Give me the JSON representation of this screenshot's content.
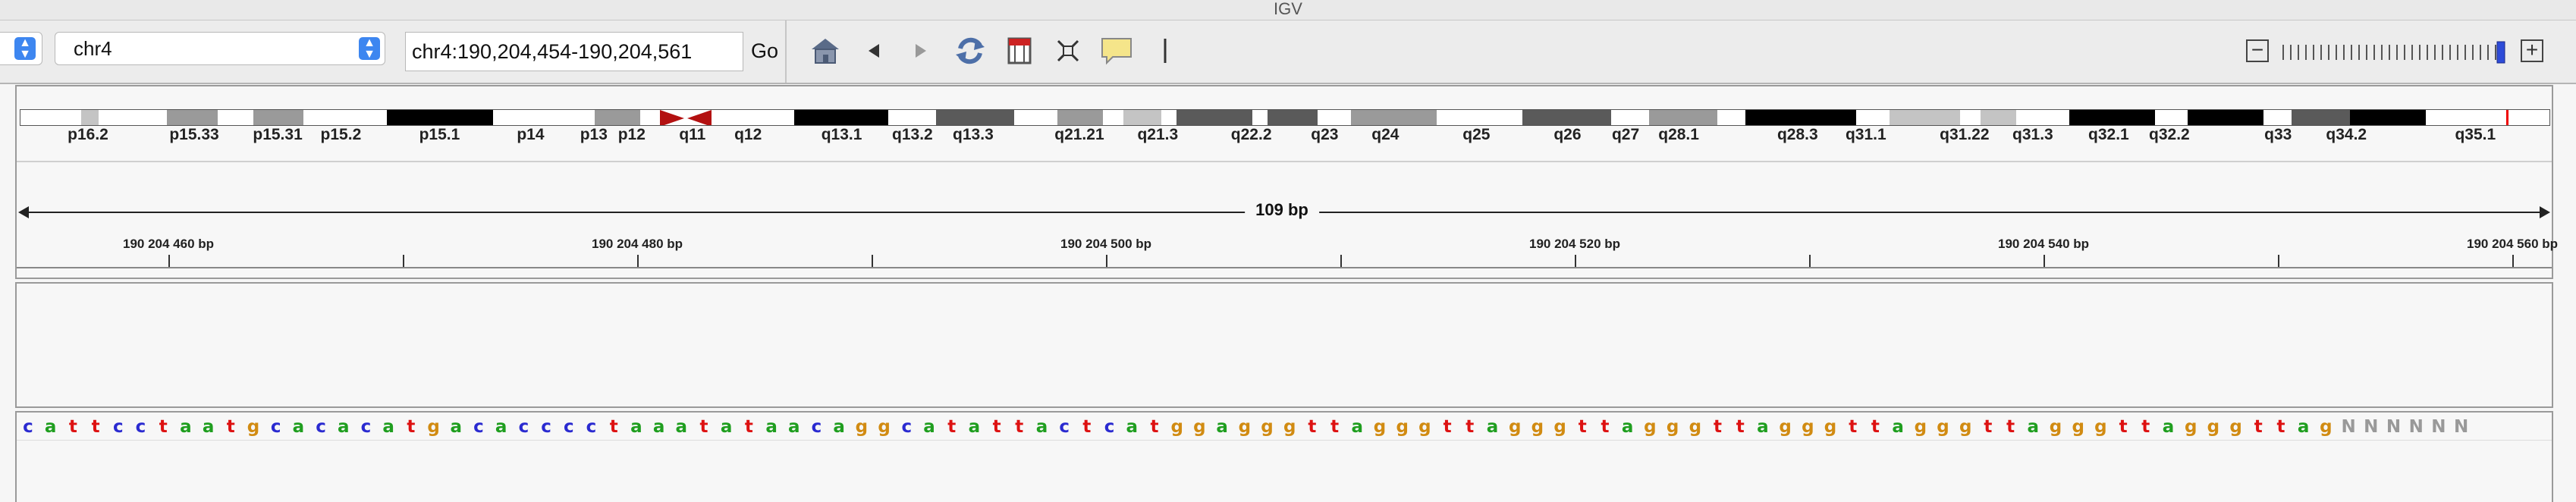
{
  "window": {
    "title": "IGV"
  },
  "toolbar": {
    "genome_select": "",
    "chromosome_select": "chr4",
    "locus": "chr4:190,204,454-190,204,561",
    "go_label": "Go",
    "icons": [
      "home-icon",
      "back-icon",
      "forward-icon",
      "refresh-icon",
      "roi-icon",
      "resize-icon",
      "popup-info-icon",
      "ruler-icon"
    ],
    "zoom_out": "−",
    "zoom_in": "+"
  },
  "ideogram": {
    "bands": [
      {
        "label": "p16.2",
        "start": 0.0,
        "end": 0.024,
        "stain": "white"
      },
      {
        "label": "",
        "start": 0.024,
        "end": 0.031,
        "stain": "lightgray"
      },
      {
        "label": "",
        "start": 0.031,
        "end": 0.058,
        "stain": "white"
      },
      {
        "label": "p15.33",
        "start": 0.058,
        "end": 0.078,
        "stain": "gray"
      },
      {
        "label": "",
        "start": 0.078,
        "end": 0.092,
        "stain": "white"
      },
      {
        "label": "p15.31",
        "start": 0.092,
        "end": 0.112,
        "stain": "gray"
      },
      {
        "label": "p15.2",
        "start": 0.112,
        "end": 0.145,
        "stain": "white"
      },
      {
        "label": "p15.1",
        "start": 0.145,
        "end": 0.187,
        "stain": "black"
      },
      {
        "label": "",
        "start": 0.187,
        "end": 0.216,
        "stain": "white"
      },
      {
        "label": "p14",
        "start": 0.216,
        "end": 0.227,
        "stain": "white"
      },
      {
        "label": "p13",
        "start": 0.227,
        "end": 0.245,
        "stain": "gray"
      },
      {
        "label": "p12",
        "start": 0.245,
        "end": 0.253,
        "stain": "white"
      },
      {
        "label": "",
        "start": 0.253,
        "end": 0.263,
        "stain": "white"
      },
      {
        "label": "q11",
        "start": 0.263,
        "end": 0.27,
        "stain": "white"
      },
      {
        "label": "",
        "start": 0.27,
        "end": 0.28,
        "stain": "white"
      },
      {
        "label": "q12",
        "start": 0.28,
        "end": 0.306,
        "stain": "white"
      },
      {
        "label": "q13.1",
        "start": 0.306,
        "end": 0.343,
        "stain": "black"
      },
      {
        "label": "q13.2",
        "start": 0.343,
        "end": 0.362,
        "stain": "white"
      },
      {
        "label": "q13.3",
        "start": 0.362,
        "end": 0.393,
        "stain": "darkgray"
      },
      {
        "label": "",
        "start": 0.393,
        "end": 0.41,
        "stain": "white"
      },
      {
        "label": "q21.21",
        "start": 0.41,
        "end": 0.428,
        "stain": "gray"
      },
      {
        "label": "",
        "start": 0.428,
        "end": 0.436,
        "stain": "white"
      },
      {
        "label": "q21.3",
        "start": 0.436,
        "end": 0.451,
        "stain": "lightgray"
      },
      {
        "label": "",
        "start": 0.451,
        "end": 0.457,
        "stain": "white"
      },
      {
        "label": "",
        "start": 0.457,
        "end": 0.487,
        "stain": "darkgray"
      },
      {
        "label": "q22.2",
        "start": 0.487,
        "end": 0.493,
        "stain": "white"
      },
      {
        "label": "",
        "start": 0.493,
        "end": 0.513,
        "stain": "darkgray"
      },
      {
        "label": "q23",
        "start": 0.513,
        "end": 0.526,
        "stain": "white"
      },
      {
        "label": "q24",
        "start": 0.526,
        "end": 0.56,
        "stain": "gray"
      },
      {
        "label": "q25",
        "start": 0.56,
        "end": 0.594,
        "stain": "white"
      },
      {
        "label": "q26",
        "start": 0.594,
        "end": 0.629,
        "stain": "darkgray"
      },
      {
        "label": "q27",
        "start": 0.629,
        "end": 0.644,
        "stain": "white"
      },
      {
        "label": "q28.1",
        "start": 0.644,
        "end": 0.671,
        "stain": "gray"
      },
      {
        "label": "",
        "start": 0.671,
        "end": 0.682,
        "stain": "white"
      },
      {
        "label": "q28.3",
        "start": 0.682,
        "end": 0.726,
        "stain": "black"
      },
      {
        "label": "q31.1",
        "start": 0.726,
        "end": 0.739,
        "stain": "white"
      },
      {
        "label": "",
        "start": 0.739,
        "end": 0.767,
        "stain": "lightgray"
      },
      {
        "label": "q31.22",
        "start": 0.767,
        "end": 0.775,
        "stain": "white"
      },
      {
        "label": "",
        "start": 0.775,
        "end": 0.789,
        "stain": "lightgray"
      },
      {
        "label": "q31.3",
        "start": 0.789,
        "end": 0.81,
        "stain": "white"
      },
      {
        "label": "q32.1",
        "start": 0.81,
        "end": 0.844,
        "stain": "black"
      },
      {
        "label": "q32.2",
        "start": 0.844,
        "end": 0.857,
        "stain": "white"
      },
      {
        "label": "",
        "start": 0.857,
        "end": 0.887,
        "stain": "black"
      },
      {
        "label": "q33",
        "start": 0.887,
        "end": 0.898,
        "stain": "white"
      },
      {
        "label": "q34.2",
        "start": 0.898,
        "end": 0.921,
        "stain": "darkgray"
      },
      {
        "label": "",
        "start": 0.921,
        "end": 0.951,
        "stain": "black"
      },
      {
        "label": "q35.1",
        "start": 0.951,
        "end": 0.985,
        "stain": "white"
      },
      {
        "label": "",
        "start": 0.985,
        "end": 1.0,
        "stain": "white"
      }
    ],
    "label_positions": {
      "p16.2": 0.027,
      "p15.33": 0.069,
      "p15.31": 0.102,
      "p15.2": 0.127,
      "p15.1": 0.166,
      "p14": 0.202,
      "p13": 0.227,
      "p12": 0.242,
      "q11": 0.266,
      "q12": 0.288,
      "q13.1": 0.325,
      "q13.2": 0.353,
      "q13.3": 0.377,
      "q21.21": 0.419,
      "q21.3": 0.45,
      "q22.2": 0.487,
      "q23": 0.516,
      "q24": 0.54,
      "q25": 0.576,
      "q26": 0.612,
      "q27": 0.635,
      "q28.1": 0.656,
      "q28.3": 0.703,
      "q31.1": 0.73,
      "q31.22": 0.769,
      "q31.3": 0.796,
      "q32.1": 0.826,
      "q32.2": 0.85,
      "q33": 0.893,
      "q34.2": 0.92,
      "q35.1": 0.971
    },
    "current_locus_fraction": 0.983
  },
  "ruler": {
    "span_label": "109 bp",
    "region_start": 190204454,
    "region_end": 190204561,
    "labeled_ticks": [
      "190 204 460 bp",
      "190 204 480 bp",
      "190 204 500 bp",
      "190 204 520 bp",
      "190 204 540 bp",
      "190 204 560 bp"
    ],
    "labeled_positions": [
      190204460,
      190204480,
      190204500,
      190204520,
      190204540,
      190204560
    ],
    "minor_positions": [
      190204470,
      190204490,
      190204510,
      190204530,
      190204550
    ]
  },
  "sequence": {
    "bases": "cattcctaatgcacacatgacacccctaaatataacaggcatattactcatggagggttagggttagggttagggttagggttagggttagggttagggttagNNNNNN",
    "colors": {
      "a": "#1f9e1f",
      "c": "#2a2ad0",
      "g": "#d18b12",
      "t": "#dd1111",
      "N": "#999999"
    }
  }
}
